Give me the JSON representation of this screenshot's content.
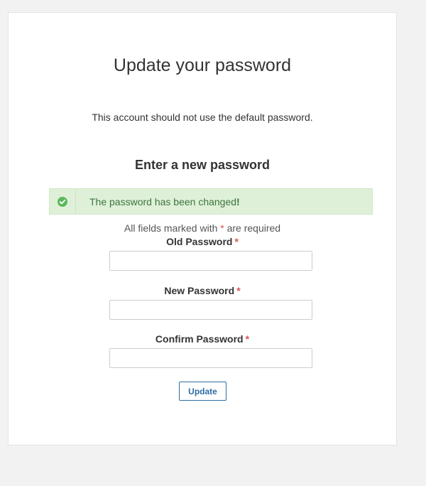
{
  "page": {
    "title": "Update your password",
    "subtitle": "This account should not use the default password.",
    "section_heading": "Enter a new password"
  },
  "alert": {
    "icon": "check-circle-icon",
    "message_prefix": "The password has been changed",
    "message_suffix": "!",
    "status_color": "#3c763d",
    "background_color": "#dff0d8"
  },
  "form": {
    "required_note_prefix": "All fields marked with ",
    "required_marker": "*",
    "required_note_suffix": " are required",
    "fields": [
      {
        "label": "Old Password",
        "value": "",
        "required_marker": "*"
      },
      {
        "label": "New Password",
        "value": "",
        "required_marker": "*"
      },
      {
        "label": "Confirm Password",
        "value": "",
        "required_marker": "*"
      }
    ],
    "submit_label": "Update"
  },
  "colors": {
    "accent": "#2e6da4",
    "required": "#d9534f",
    "success_icon": "#5cb85c"
  }
}
